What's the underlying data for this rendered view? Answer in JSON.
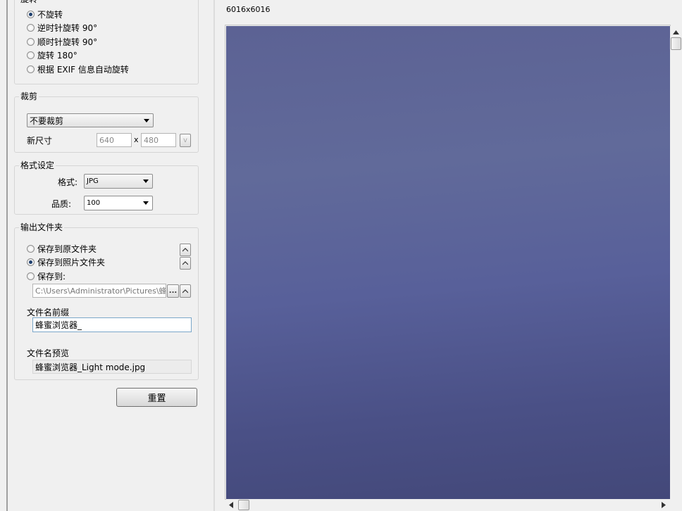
{
  "rotation": {
    "legend": "旋转",
    "options": [
      "不旋转",
      "逆时针旋转 90°",
      "顺时针旋转 90°",
      "旋转 180°",
      "根据 EXIF 信息自动旋转"
    ],
    "selected_index": 0
  },
  "crop": {
    "legend": "裁剪",
    "mode_value": "不要裁剪",
    "new_size_label": "新尺寸",
    "width_value": "640",
    "times_symbol": "x",
    "height_value": "480",
    "lock_button": "v"
  },
  "format": {
    "legend": "格式设定",
    "format_label": "格式:",
    "format_value": "JPG",
    "quality_label": "品质:",
    "quality_value": "100"
  },
  "output": {
    "legend": "输出文件夹",
    "options": [
      "保存到原文件夹",
      "保存到照片文件夹",
      "保存到:"
    ],
    "selected_index": 1,
    "path_value": "C:\\Users\\Administrator\\Pictures\\蜂蜜浏",
    "browse_button": "...",
    "prefix_label": "文件名前缀",
    "prefix_value": "蜂蜜浏览器_",
    "preview_label": "文件名预览",
    "preview_value": "蜂蜜浏览器_Light mode.jpg"
  },
  "reset_button": "重置",
  "preview": {
    "dimensions": "6016x6016"
  }
}
